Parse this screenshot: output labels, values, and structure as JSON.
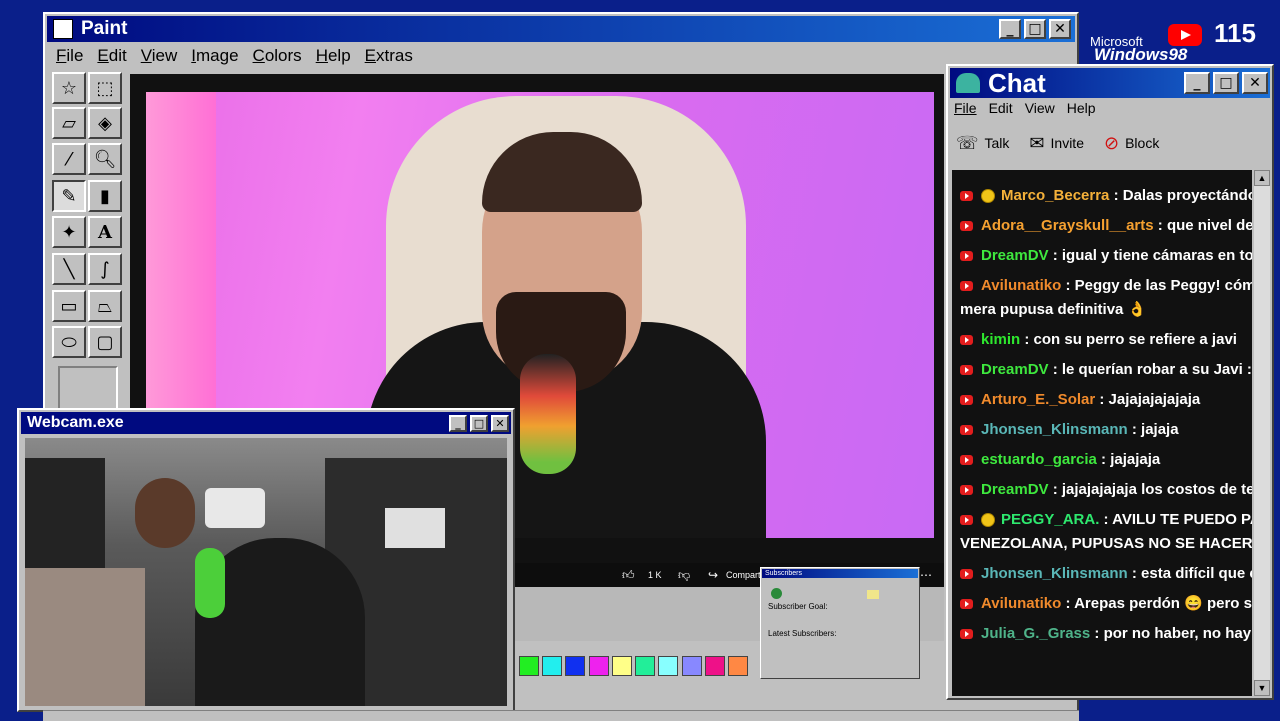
{
  "paint": {
    "title": "Paint",
    "menu": [
      "File",
      "Edit",
      "View",
      "Image",
      "Colors",
      "Help",
      "Extras"
    ],
    "palette": [
      "#22ee22",
      "#22eeee",
      "#1030f0",
      "#ee22ee",
      "#ffff88",
      "#22ee99",
      "#88ffff",
      "#8888ff",
      "#ee1188",
      "#ff8844"
    ]
  },
  "badge_win98": {
    "line1": "Microsoft",
    "line2": "Windows98",
    "count": "115"
  },
  "video": {
    "likes": "1 K",
    "share": "Compartir"
  },
  "webcam": {
    "title": "Webcam.exe"
  },
  "subs": {
    "title": "Subscribers",
    "goal": "Subscriber Goal:",
    "latest": "Latest Subscribers:"
  },
  "chat": {
    "title": "Chat",
    "menu": [
      "File",
      "Edit",
      "View",
      "Help"
    ],
    "actions": {
      "talk": "Talk",
      "invite": "Invite",
      "block": "Block"
    },
    "messages": [
      {
        "user": "Marco_Becerra",
        "color": "#f5b13a",
        "badge": true,
        "text": " : Dalas proyectándose c"
      },
      {
        "user": "Adora__Grayskull__arts",
        "color": "#f5a030",
        "badge": false,
        "text": " : que nivel de par"
      },
      {
        "user": "DreamDV",
        "color": "#3ee83e",
        "badge": false,
        "text": " : igual y tiene cámaras en toda l"
      },
      {
        "user": "Avilunatiko",
        "color": "#f08a2c",
        "badge": false,
        "text": " : Peggy de las Peggy! cómo a",
        "cont": "mera pupusa definitiva 👌"
      },
      {
        "user": "kimin",
        "color": "#2ee82e",
        "badge": false,
        "text": " : con su perro se refiere a javi"
      },
      {
        "user": "DreamDV",
        "color": "#3ee83e",
        "badge": false,
        "text": " : le querían robar a su Javi :("
      },
      {
        "user": "Arturo_E._Solar",
        "color": "#f08a2c",
        "badge": false,
        "text": " : Jajajajajajaja"
      },
      {
        "user": "Jhonsen_Klinsmann",
        "color": "#5ab7b7",
        "badge": false,
        "text": " : jajaja"
      },
      {
        "user": "estuardo_garcia",
        "color": "#3ee83e",
        "badge": false,
        "text": " : jajajaja"
      },
      {
        "user": "DreamDV",
        "color": "#3ee83e",
        "badge": false,
        "text": " : jajajajajaja los costos de tener"
      },
      {
        "user": "PEGGY_ARA.",
        "color": "#2ee86e",
        "badge": true,
        "text": " : AVILU TE PUEDO PASAR",
        "cont": "VENEZOLANA, PUPUSAS NO SE HACER 😀"
      },
      {
        "user": "Jhonsen_Klinsmann",
        "color": "#5ab7b7",
        "badge": false,
        "text": " : esta difícil que el ve"
      },
      {
        "user": "Avilunatiko",
        "color": "#f08a2c",
        "badge": false,
        "text": " : Arepas perdón 😄 pero si, lue"
      },
      {
        "user": "Julia_G._Grass",
        "color": "#4fb48a",
        "badge": false,
        "text": " : por no haber, no hay ni ba"
      }
    ]
  }
}
